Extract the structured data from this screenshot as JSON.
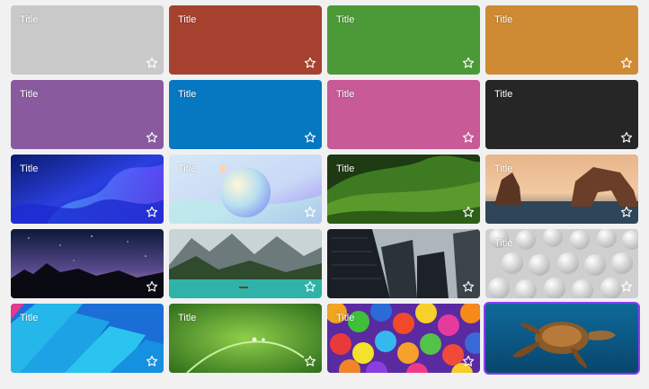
{
  "cards": [
    {
      "title": "Title",
      "bg": "#c9c9c9",
      "art": "solid"
    },
    {
      "title": "Title",
      "bg": "#a6412f",
      "art": "solid"
    },
    {
      "title": "Title",
      "bg": "#4c9a37",
      "art": "solid"
    },
    {
      "title": "Title",
      "bg": "#cf8a34",
      "art": "solid"
    },
    {
      "title": "Title",
      "bg": "#8a5a9f",
      "art": "solid"
    },
    {
      "title": "Title",
      "bg": "#0677c1",
      "art": "solid"
    },
    {
      "title": "Title",
      "bg": "#c75a97",
      "art": "solid"
    },
    {
      "title": "Title",
      "bg": "#262626",
      "art": "solid"
    },
    {
      "title": "Title",
      "art": "blue-waves"
    },
    {
      "title": "Title",
      "art": "pastel-sphere"
    },
    {
      "title": "Title",
      "art": "green-hills"
    },
    {
      "title": "Title",
      "art": "sea-rocks"
    },
    {
      "title": "",
      "art": "night-sky"
    },
    {
      "title": "",
      "art": "mountain-lake"
    },
    {
      "title": "",
      "art": "skyscrapers"
    },
    {
      "title": "Title",
      "art": "white-spheres"
    },
    {
      "title": "Title",
      "art": "cyan-layers"
    },
    {
      "title": "Title",
      "art": "grass-dew"
    },
    {
      "title": "Title",
      "art": "color-balls"
    },
    {
      "title": "",
      "art": "sea-turtle",
      "selected": true
    }
  ],
  "icons": {
    "favorite": "star-outline-icon"
  }
}
